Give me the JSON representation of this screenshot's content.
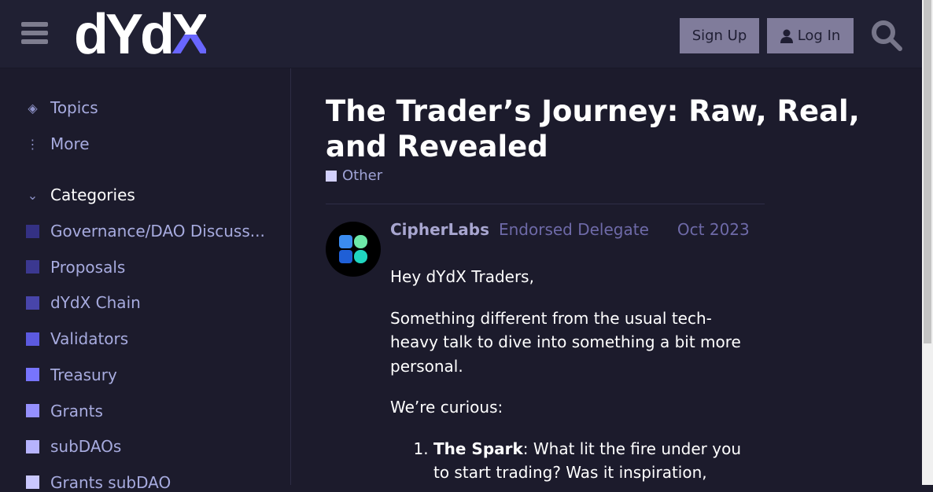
{
  "header": {
    "logo": "dYdX",
    "sign_up": "Sign Up",
    "log_in": "Log In"
  },
  "sidebar": {
    "topics": "Topics",
    "more": "More",
    "categories": "Categories",
    "items": [
      {
        "label": "Governance/DAO Discuss...",
        "color": "#343184"
      },
      {
        "label": "Proposals",
        "color": "#3b3890"
      },
      {
        "label": "dYdX Chain",
        "color": "#4845aa"
      },
      {
        "label": "Validators",
        "color": "#5c5ae0"
      },
      {
        "label": "Treasury",
        "color": "#7774fe"
      },
      {
        "label": "Grants",
        "color": "#9590fd"
      },
      {
        "label": "subDAOs",
        "color": "#b6b3fd"
      },
      {
        "label": "Grants subDAO",
        "color": "#c9c7fd"
      }
    ]
  },
  "topic": {
    "title": "The Trader’s Journey: Raw, Real, and Revealed",
    "category": "Other"
  },
  "post": {
    "username": "CipherLabs",
    "user_title": "Endorsed Delegate",
    "date": "Oct 2023",
    "greeting": "Hey dYdX Traders,",
    "intro": "Something different from the usual tech-heavy talk to dive into something a bit more personal.",
    "curious": "We’re curious:",
    "list": [
      {
        "bold": "The Spark",
        "text": ": What lit the fire under you to start trading? Was it inspiration,"
      }
    ]
  }
}
